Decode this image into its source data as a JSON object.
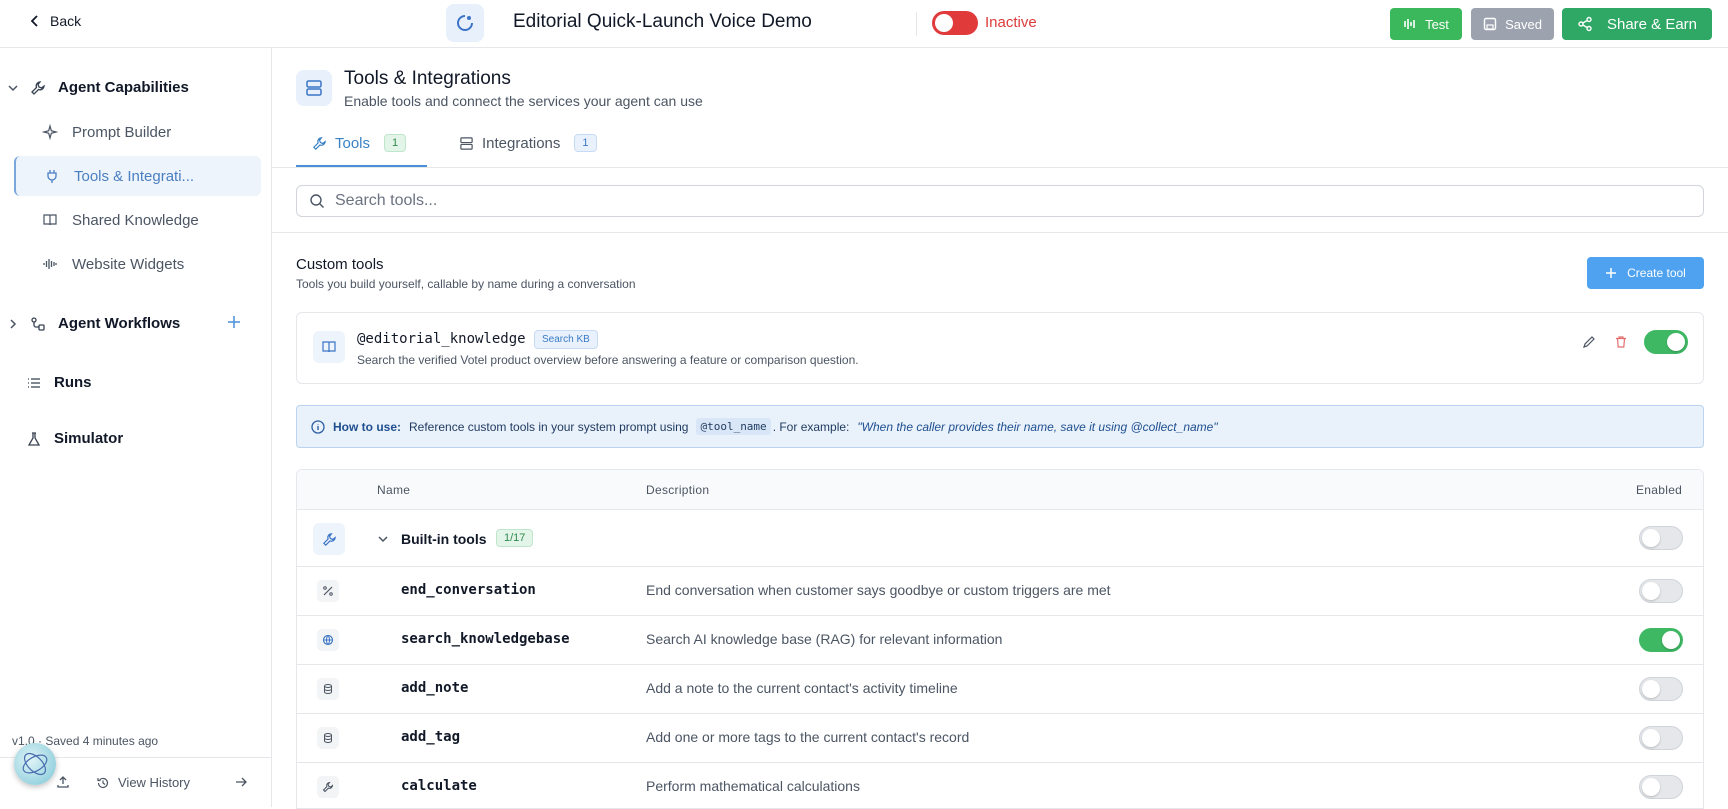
{
  "topbar": {
    "back_label": "Back",
    "agent_title": "Editorial Quick-Launch Voice Demo",
    "status": "Inactive",
    "test_label": "Test",
    "saved_label": "Saved",
    "share_label": "Share & Earn"
  },
  "sidebar": {
    "capabilities_label": "Agent Capabilities",
    "items": [
      {
        "label": "Prompt Builder",
        "icon": "sparkle-icon"
      },
      {
        "label": "Tools & Integrati...",
        "icon": "plug-icon"
      },
      {
        "label": "Shared Knowledge",
        "icon": "book-icon"
      },
      {
        "label": "Website Widgets",
        "icon": "audio-wave-icon"
      }
    ],
    "workflows_label": "Agent Workflows",
    "runs_label": "Runs",
    "simulator_label": "Simulator",
    "saved_note": "v1.0 · Saved 4 minutes ago",
    "view_history_label": "View History"
  },
  "header": {
    "title": "Tools & Integrations",
    "subtitle": "Enable tools and connect the services your agent can use"
  },
  "tabs": [
    {
      "label": "Tools",
      "count": "1"
    },
    {
      "label": "Integrations",
      "count": "1"
    }
  ],
  "search": {
    "placeholder": "Search tools..."
  },
  "custom_tools": {
    "title": "Custom tools",
    "subtitle": "Tools you build yourself, callable by name during a conversation",
    "create_label": "Create tool",
    "items": [
      {
        "name": "@editorial_knowledge",
        "badge": "Search KB",
        "description": "Search the verified Votel product overview before answering a feature or comparison question.",
        "enabled": true
      }
    ]
  },
  "howto": {
    "title": "How to use:",
    "text1": "Reference custom tools in your system prompt using",
    "code": "@tool_name",
    "text2": ". For example:",
    "example": "\"When the caller provides their name, save it using @collect_name\""
  },
  "table": {
    "headers": {
      "name": "Name",
      "description": "Description",
      "enabled": "Enabled"
    },
    "group": {
      "label": "Built-in tools",
      "count": "1/17",
      "enabled": false
    },
    "rows": [
      {
        "name": "end_conversation",
        "description": "End conversation when customer says goodbye or custom triggers are met",
        "icon": "percent-icon",
        "enabled": false
      },
      {
        "name": "search_knowledgebase",
        "description": "Search AI knowledge base (RAG) for relevant information",
        "icon": "globe-icon",
        "enabled": true
      },
      {
        "name": "add_note",
        "description": "Add a note to the current contact's activity timeline",
        "icon": "database-icon",
        "enabled": false
      },
      {
        "name": "add_tag",
        "description": "Add one or more tags to the current contact's record",
        "icon": "database-icon",
        "enabled": false
      },
      {
        "name": "calculate",
        "description": "Perform mathematical calculations",
        "icon": "wrench-icon",
        "enabled": false
      }
    ]
  },
  "colors": {
    "accent": "#4a90d9",
    "green": "#3fb864",
    "inactive_red": "#dc3b3b"
  }
}
